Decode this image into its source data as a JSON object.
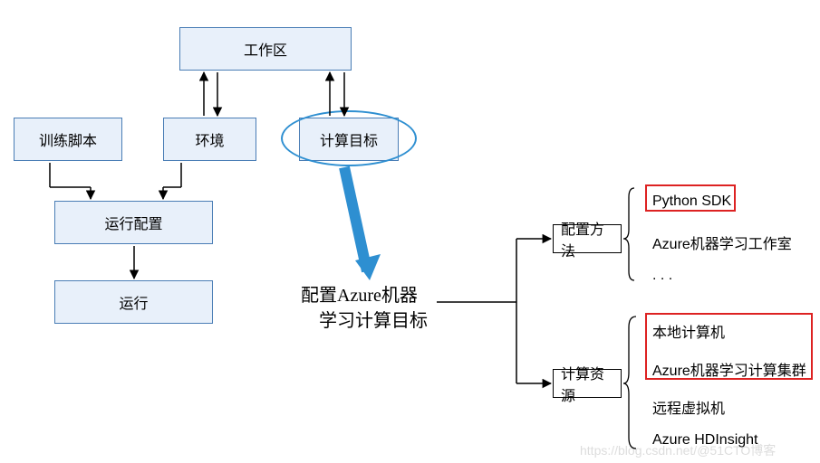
{
  "chart_data": {
    "type": "diagram",
    "title": "配置Azure机器学习计算目标",
    "nodes": [
      {
        "id": "workspace",
        "label": "工作区",
        "style": "blue"
      },
      {
        "id": "train_script",
        "label": "训练脚本",
        "style": "blue"
      },
      {
        "id": "environment",
        "label": "环境",
        "style": "blue"
      },
      {
        "id": "compute_target",
        "label": "计算目标",
        "style": "blue",
        "highlighted": "ellipse"
      },
      {
        "id": "run_config",
        "label": "运行配置",
        "style": "blue"
      },
      {
        "id": "run",
        "label": "运行",
        "style": "blue"
      },
      {
        "id": "config_azure_ml_compute",
        "label": "配置Azure机器学习计算目标",
        "style": "text"
      },
      {
        "id": "config_method",
        "label": "配置方法",
        "style": "plain"
      },
      {
        "id": "compute_resource",
        "label": "计算资源",
        "style": "plain"
      },
      {
        "id": "python_sdk",
        "label": "Python SDK",
        "style": "text",
        "highlighted": "red"
      },
      {
        "id": "aml_studio",
        "label": "Azure机器学习工作室",
        "style": "text"
      },
      {
        "id": "ellipsis",
        "label": "...",
        "style": "text"
      },
      {
        "id": "local_computer",
        "label": "本地计算机",
        "style": "text",
        "highlighted": "red"
      },
      {
        "id": "aml_compute_cluster",
        "label": "Azure机器学习计算集群",
        "style": "text",
        "highlighted": "red"
      },
      {
        "id": "remote_vm",
        "label": "远程虚拟机",
        "style": "text"
      },
      {
        "id": "hdinsight",
        "label": "Azure HDInsight",
        "style": "text"
      }
    ],
    "edges": [
      {
        "from": "workspace",
        "to": "environment",
        "dir": "both"
      },
      {
        "from": "workspace",
        "to": "compute_target",
        "dir": "both"
      },
      {
        "from": "train_script",
        "to": "run_config",
        "dir": "forward"
      },
      {
        "from": "environment",
        "to": "run_config",
        "dir": "forward"
      },
      {
        "from": "run_config",
        "to": "run",
        "dir": "forward"
      },
      {
        "from": "compute_target",
        "to": "config_azure_ml_compute",
        "dir": "forward",
        "style": "thick"
      },
      {
        "from": "config_azure_ml_compute",
        "to": "config_method",
        "dir": "forward"
      },
      {
        "from": "config_azure_ml_compute",
        "to": "compute_resource",
        "dir": "forward"
      },
      {
        "from": "config_method",
        "to": "python_sdk",
        "dir": "bracket"
      },
      {
        "from": "config_method",
        "to": "aml_studio",
        "dir": "bracket"
      },
      {
        "from": "config_method",
        "to": "ellipsis",
        "dir": "bracket"
      },
      {
        "from": "compute_resource",
        "to": "local_computer",
        "dir": "bracket"
      },
      {
        "from": "compute_resource",
        "to": "aml_compute_cluster",
        "dir": "bracket"
      },
      {
        "from": "compute_resource",
        "to": "remote_vm",
        "dir": "bracket"
      },
      {
        "from": "compute_resource",
        "to": "hdinsight",
        "dir": "bracket"
      }
    ],
    "watermark": "https://blog.csdn.net/@51CTO博客"
  },
  "nodes": {
    "workspace": "工作区",
    "train_script": "训练脚本",
    "environment": "环境",
    "compute_target": "计算目标",
    "run_config": "运行配置",
    "run": "运行",
    "center_l1": "配置Azure机器",
    "center_l2": "学习计算目标",
    "config_method": "配置方法",
    "compute_resource": "计算资源",
    "python_sdk": "Python SDK",
    "aml_studio": "Azure机器学习工作室",
    "ellipsis": ". . .",
    "local_computer": "本地计算机",
    "aml_compute_cluster": "Azure机器学习计算集群",
    "remote_vm": "远程虚拟机",
    "hdinsight": "Azure HDInsight"
  },
  "watermark": "https://blog.csdn.net/@51CTO博客"
}
